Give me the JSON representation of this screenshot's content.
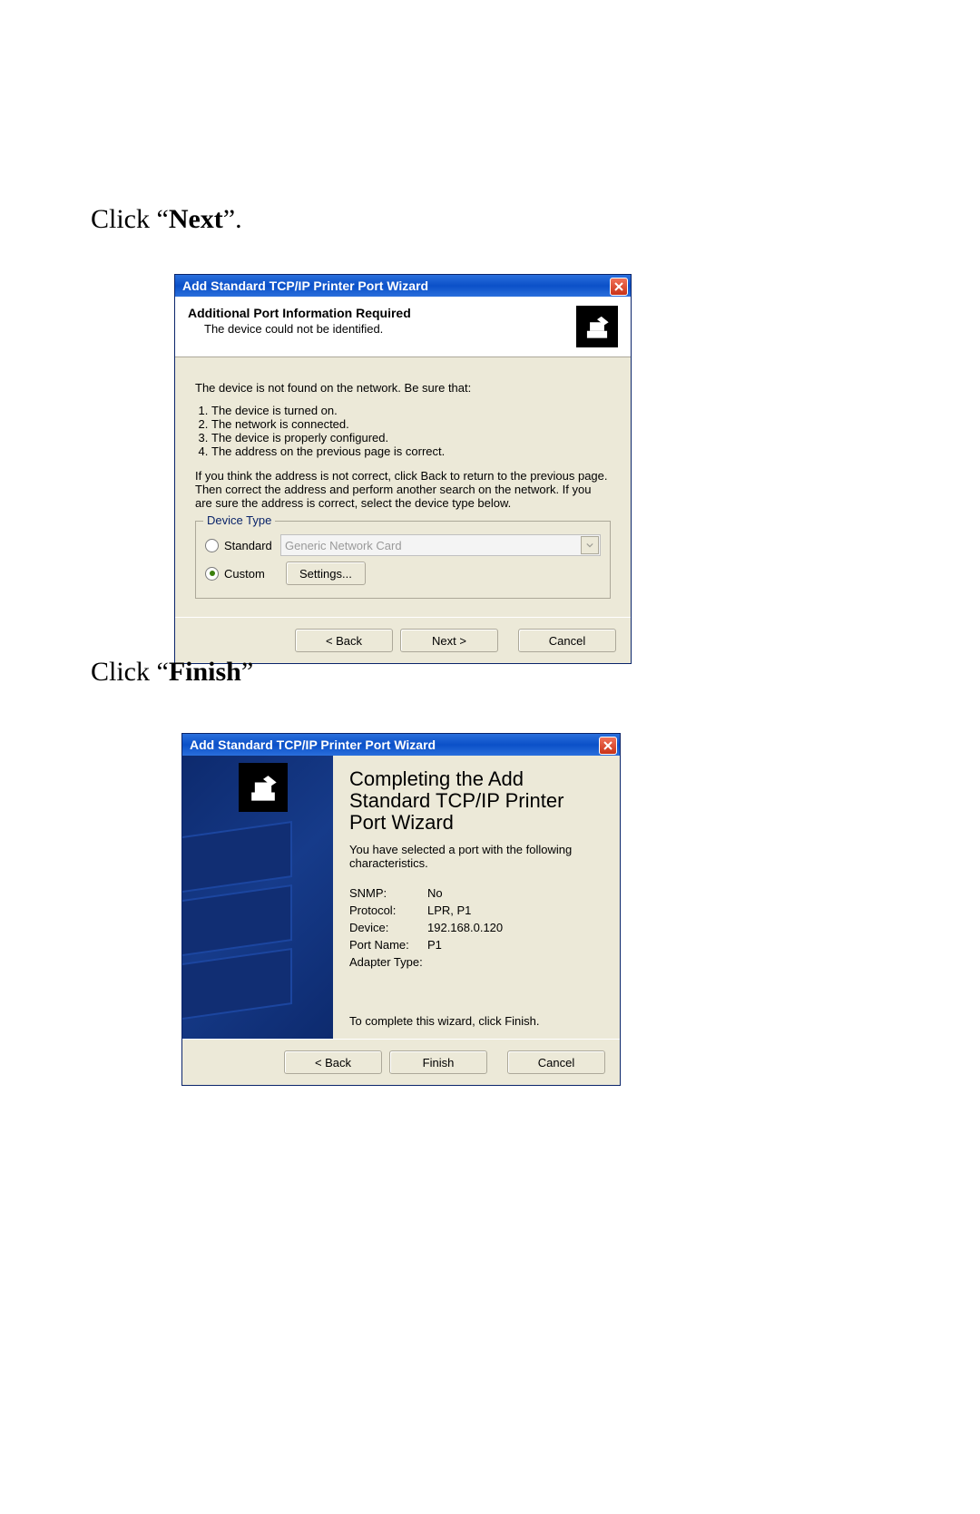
{
  "instructions": {
    "step1_pre": "Click “",
    "step1_bold": "Next",
    "step1_post": "”.",
    "step2_pre": "Click “",
    "step2_bold": "Finish",
    "step2_post": "”"
  },
  "dialog1": {
    "title": "Add Standard TCP/IP Printer Port Wizard",
    "header_bold": "Additional Port Information Required",
    "header_sub": "The device could not be identified.",
    "body_lead": "The device is not found on the network.  Be sure that:",
    "list": [
      "The device is turned on.",
      "The network is connected.",
      "The device is properly configured.",
      "The address on the previous page is correct."
    ],
    "body_para": "If you think the address is not correct, click Back to return to the previous page.  Then correct the address and perform another search on the network.  If you are sure the address is correct, select the device type below.",
    "group_legend": "Device Type",
    "radio_standard": "Standard",
    "combo_value": "Generic Network Card",
    "radio_custom": "Custom",
    "settings_btn": "Settings...",
    "back_btn": "< Back",
    "next_btn": "Next >",
    "cancel_btn": "Cancel"
  },
  "dialog2": {
    "title": "Add Standard TCP/IP Printer Port Wizard",
    "heading": "Completing the Add Standard TCP/IP Printer Port Wizard",
    "sub": "You have selected a port with the following characteristics.",
    "rows": [
      {
        "k": "SNMP:",
        "v": "No"
      },
      {
        "k": "Protocol:",
        "v": "LPR, P1"
      },
      {
        "k": "Device:",
        "v": "192.168.0.120"
      },
      {
        "k": "Port Name:",
        "v": "P1"
      },
      {
        "k": "Adapter Type:",
        "v": ""
      }
    ],
    "complete": "To complete this wizard, click Finish.",
    "back_btn": "< Back",
    "finish_btn": "Finish",
    "cancel_btn": "Cancel"
  }
}
